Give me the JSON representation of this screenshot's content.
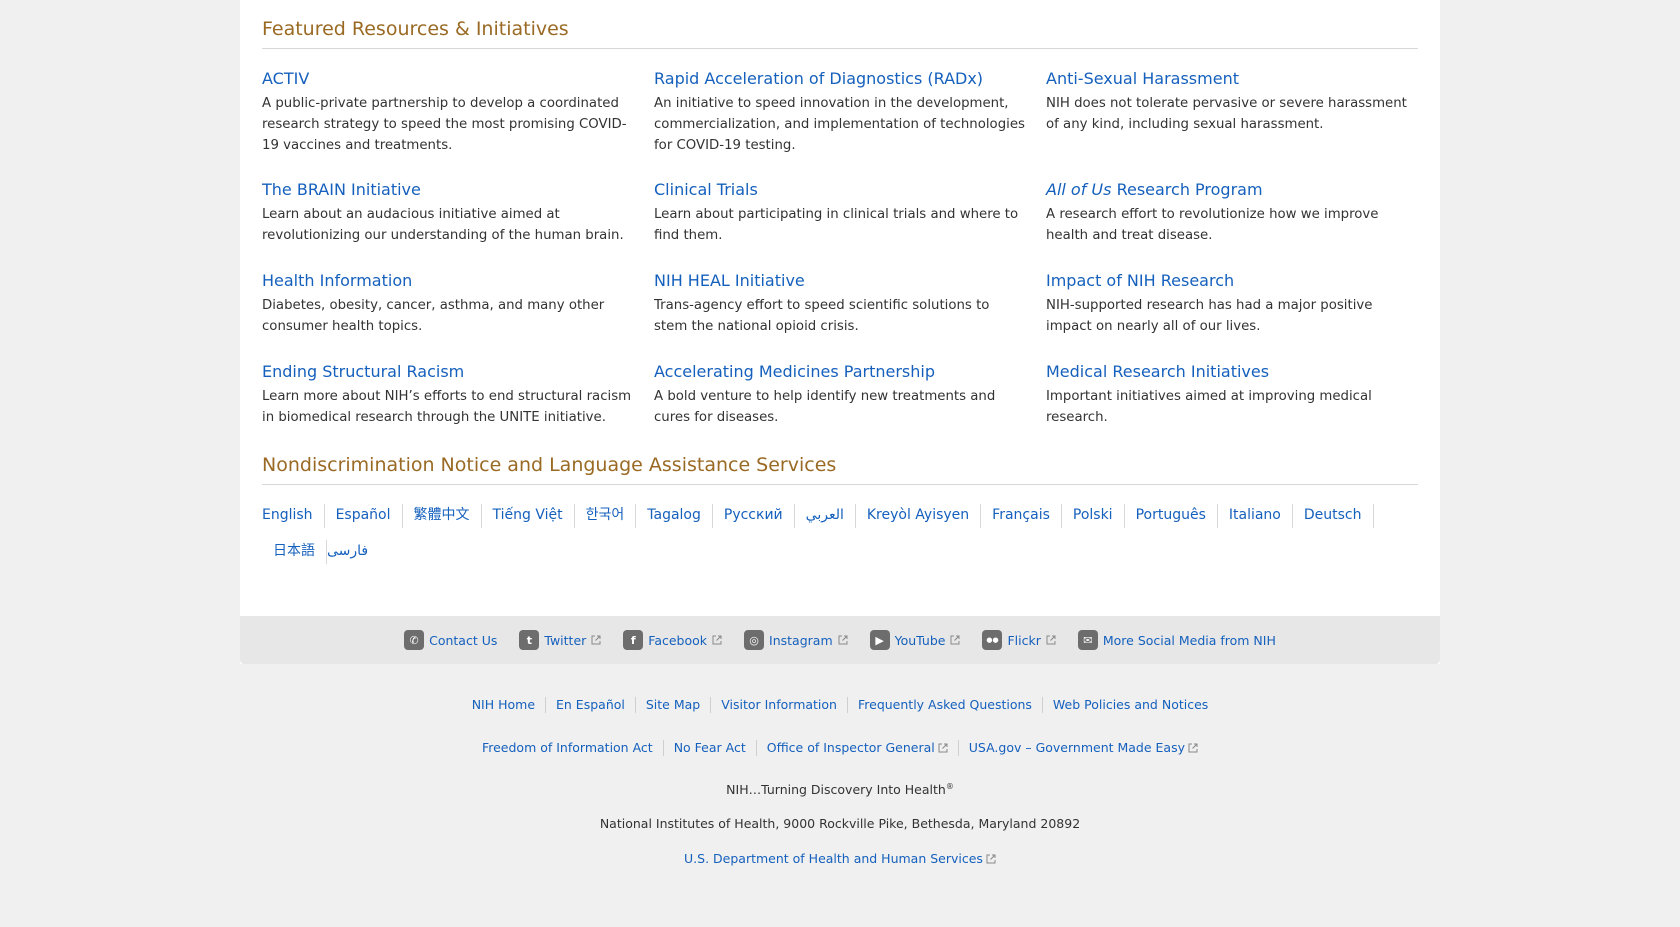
{
  "featured": {
    "heading": "Featured Resources & Initiatives",
    "items": [
      {
        "title": "ACTIV",
        "desc": "A public-private partnership to develop a coordinated research strategy to speed the most promising COVID-19 vaccines and treatments."
      },
      {
        "title": "Rapid Acceleration of Diagnostics (RADx)",
        "desc": "An initiative to speed innovation in the development, commercialization, and implementation of technologies for COVID-19 testing."
      },
      {
        "title": "Anti-Sexual Harassment",
        "desc": "NIH does not tolerate pervasive or severe harassment of any kind, including sexual harassment."
      },
      {
        "title": "The BRAIN Initiative",
        "desc": "Learn about an audacious initiative aimed at revolutionizing our understanding of the human brain."
      },
      {
        "title": "Clinical Trials",
        "desc": "Learn about participating in clinical trials and where to find them."
      },
      {
        "title_em": "All of Us",
        "title_rest": " Research Program",
        "desc": "A research effort to revolutionize how we improve health and treat disease."
      },
      {
        "title": "Health Information",
        "desc": "Diabetes, obesity, cancer, asthma, and many other consumer health topics."
      },
      {
        "title": "NIH HEAL Initiative",
        "desc": "Trans-agency effort to speed scientific solutions to stem the national opioid crisis."
      },
      {
        "title": "Impact of NIH Research",
        "desc": "NIH-supported research has had a major positive impact on nearly all of our lives."
      },
      {
        "title": "Ending Structural Racism",
        "desc": "Learn more about NIH’s efforts to end structural racism in biomedical research through the UNITE initiative."
      },
      {
        "title": "Accelerating Medicines Partnership",
        "desc": "A bold venture to help identify new treatments and cures for diseases."
      },
      {
        "title": "Medical Research Initiatives",
        "desc": "Important initiatives aimed at improving medical research."
      }
    ]
  },
  "nondiscrimination": {
    "heading": "Nondiscrimination Notice and Language Assistance Services",
    "languages": [
      "English",
      "Español",
      "繁體中文",
      "Tiếng Việt",
      "한국어",
      "Tagalog",
      "Русский",
      "العربي",
      "Kreyòl Ayisyen",
      "Français",
      "Polski",
      "Português",
      "Italiano",
      "Deutsch",
      "日本語",
      "فارسی"
    ]
  },
  "social": [
    {
      "label": "Contact Us",
      "icon": "phone-icon",
      "glyph": "✆",
      "external": false
    },
    {
      "label": "Twitter",
      "icon": "twitter-icon",
      "glyph": "t",
      "external": true
    },
    {
      "label": "Facebook",
      "icon": "facebook-icon",
      "glyph": "f",
      "external": true
    },
    {
      "label": "Instagram",
      "icon": "instagram-icon",
      "glyph": "◎",
      "external": true
    },
    {
      "label": "YouTube",
      "icon": "youtube-icon",
      "glyph": "▶",
      "external": true
    },
    {
      "label": "Flickr",
      "icon": "flickr-icon",
      "glyph": "●●",
      "external": true
    },
    {
      "label": "More Social Media from NIH",
      "icon": "chat-bubbles-icon",
      "glyph": "✉",
      "external": false
    }
  ],
  "footer": {
    "links_row1": [
      "NIH Home",
      "En Español",
      "Site Map",
      "Visitor Information",
      "Frequently Asked Questions",
      "Web Policies and Notices"
    ],
    "links_row2": [
      {
        "label": "Freedom of Information Act",
        "external": false
      },
      {
        "label": "No Fear Act",
        "external": false
      },
      {
        "label": "Office of Inspector General",
        "external": true
      },
      {
        "label": "USA.gov – Government Made Easy",
        "external": true
      }
    ],
    "tagline": "NIH…Turning Discovery Into Health",
    "tagline_mark": "®",
    "address": "National Institutes of Health, 9000 Rockville Pike, Bethesda, Maryland 20892",
    "hhs_link": "U.S. Department of Health and Human Services"
  },
  "colors": {
    "link": "#1560bd",
    "heading": "#9a6a24",
    "background": "#f0f0f0"
  }
}
